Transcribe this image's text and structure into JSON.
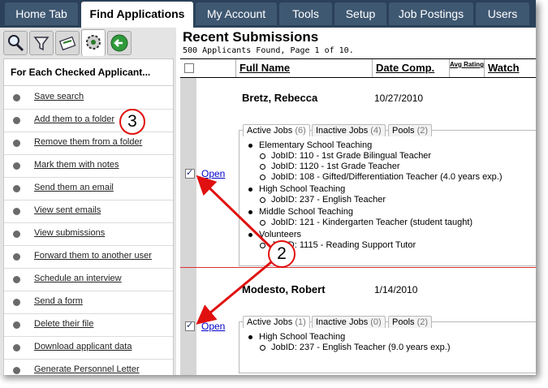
{
  "nav": {
    "tabs": [
      {
        "label": "Home Tab",
        "active": false
      },
      {
        "label": "Find Applications",
        "active": true
      },
      {
        "label": "My Account",
        "active": false
      },
      {
        "label": "Tools",
        "active": false
      },
      {
        "label": "Setup",
        "active": false
      },
      {
        "label": "Job Postings",
        "active": false
      },
      {
        "label": "Users",
        "active": false
      }
    ]
  },
  "left_panel": {
    "icons": [
      "search-icon",
      "filter-icon",
      "notes-icon",
      "settings-icon",
      "back-arrow-icon"
    ],
    "header": "For Each Checked Applicant...",
    "actions": [
      "Save search",
      "Add them to a folder",
      "Remove them from a folder",
      "Mark them with notes",
      "Send them an email",
      "View sent emails",
      "View submissions",
      "Forward them to another user",
      "Schedule an interview",
      "Send a form",
      "Delete their file",
      "Download applicant data",
      "Generate Personnel Letter"
    ]
  },
  "main": {
    "title": "Recent Submissions",
    "subtitle": "500 Applicants Found, Page 1 of 10.",
    "columns": {
      "full_name": "Full Name",
      "date_comp": "Date Comp.",
      "avg_rating": "Avg Rating",
      "watch": "Watch"
    },
    "open_label": "Open",
    "applicants": [
      {
        "name": "Bretz,   Rebecca",
        "date": "10/27/2010",
        "checked": true,
        "tabs": [
          {
            "label": "Active Jobs",
            "count": "(6)"
          },
          {
            "label": "Inactive Jobs",
            "count": "(4)"
          },
          {
            "label": "Pools",
            "count": "(2)"
          }
        ],
        "lines": [
          {
            "level": 1,
            "text": "Elementary School Teaching"
          },
          {
            "level": 2,
            "text": "JobID: 110 - 1st Grade Bilingual Teacher"
          },
          {
            "level": 2,
            "text": "JobID: 1120 - 1st Grade Teacher"
          },
          {
            "level": 2,
            "text": "JobID: 108 - Gifted/Differentiation Teacher   (4.0 years exp.)"
          },
          {
            "level": 1,
            "text": "High School Teaching"
          },
          {
            "level": 2,
            "text": "JobID: 237 - English Teacher"
          },
          {
            "level": 1,
            "text": "Middle School Teaching"
          },
          {
            "level": 2,
            "text": "JobID: 121 - Kindergarten Teacher   (student taught)"
          },
          {
            "level": 1,
            "text": "Volunteers"
          },
          {
            "level": 2,
            "text": "JobID: 1115 - Reading Support Tutor"
          }
        ]
      },
      {
        "name": "Modesto,   Robert",
        "date": "1/14/2010",
        "checked": true,
        "tabs": [
          {
            "label": "Active Jobs",
            "count": "(1)"
          },
          {
            "label": "Inactive Jobs",
            "count": "(0)"
          },
          {
            "label": "Pools",
            "count": "(2)"
          }
        ],
        "lines": [
          {
            "level": 1,
            "text": "High School Teaching"
          },
          {
            "level": 2,
            "text": "JobID: 237 - English Teacher   (9.0 years exp.)"
          }
        ]
      }
    ]
  },
  "callouts": {
    "two": "2",
    "three": "3"
  },
  "colors": {
    "nav_bg": "#2b4159",
    "tab_bg": "#3f5872",
    "callout": "#e01010",
    "link": "#0000cc"
  }
}
